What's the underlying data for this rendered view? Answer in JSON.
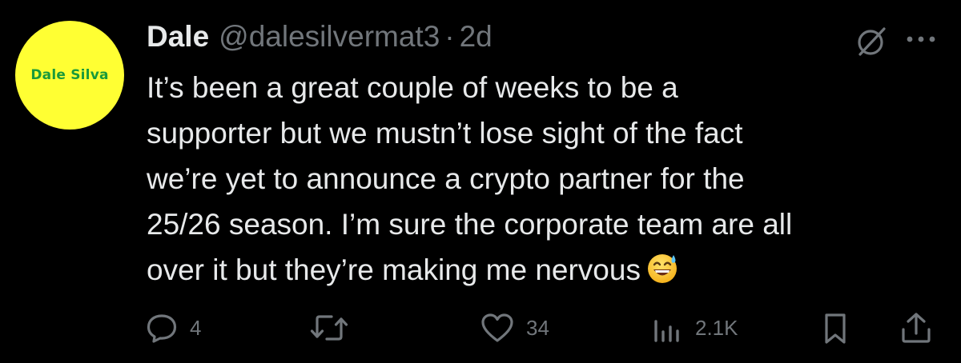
{
  "author": {
    "name": "Dale",
    "handle": "@dalesilvermat3",
    "separator": "·",
    "time": "2d",
    "avatar_text": "Dale Silva"
  },
  "tweet": {
    "text": "It’s been a great couple of weeks to be a\nsupporter but we mustn’t lose sight of the fact\nwe’re yet to announce a crypto partner for the\n25/26 season. I’m sure the corporate team are all\nover it but they’re making me nervous",
    "emoji": "sweat-smile-emoji"
  },
  "actions": {
    "replies": "4",
    "reposts": "",
    "likes": "34",
    "views": "2.1K"
  },
  "icons": [
    "grok-icon",
    "more-icon",
    "reply-icon",
    "repost-icon",
    "like-icon",
    "views-icon",
    "bookmark-icon",
    "share-icon"
  ],
  "colors": {
    "background": "#000000",
    "primary_text": "#e7e9ea",
    "secondary_text": "#71767b",
    "avatar_bg": "#ffff33",
    "avatar_text": "#1a9a3a"
  }
}
